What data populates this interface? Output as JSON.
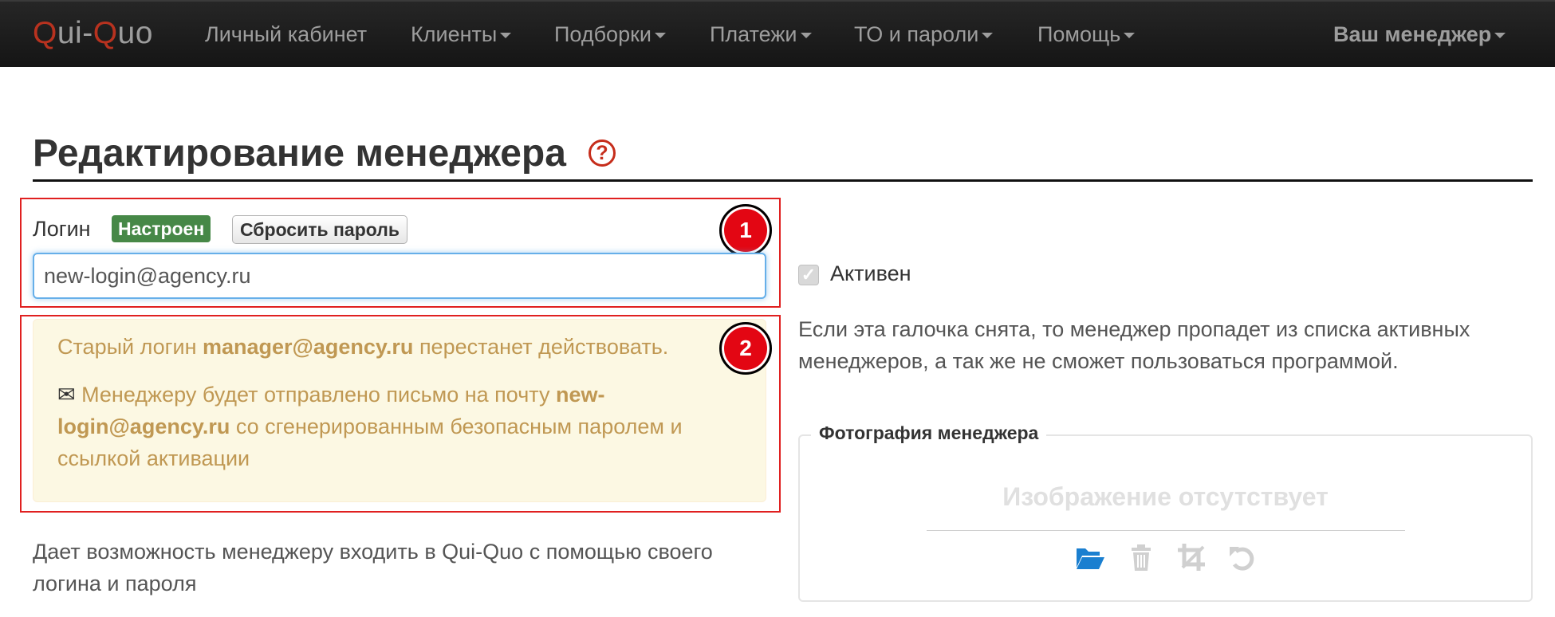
{
  "navbar": {
    "brand_q1": "Q",
    "brand_mid": "ui-",
    "brand_q2": "Q",
    "brand_end": "uo",
    "items": [
      {
        "label": "Личный кабинет"
      },
      {
        "label": "Клиенты"
      },
      {
        "label": "Подборки"
      },
      {
        "label": "Платежи"
      },
      {
        "label": "ТО и пароли"
      },
      {
        "label": "Помощь"
      }
    ],
    "manager_menu": "Ваш менеджер"
  },
  "page": {
    "title": "Редактирование менеджера",
    "help_symbol": "?"
  },
  "annotations": {
    "badge1": "1",
    "badge2": "2"
  },
  "login": {
    "label": "Логин",
    "status": "Настроен",
    "reset_button": "Сбросить пароль",
    "value": "new-login@agency.ru",
    "help_text": "Дает возможность менеджеру входить в Qui-Quo с помощью своего логина и пароля"
  },
  "warning": {
    "line1_prefix": "Старый логин ",
    "line1_email": "manager@agency.ru",
    "line1_suffix": " перестанет действовать.",
    "mail_glyph": "✉",
    "line2_prefix": " Менеджеру будет отправлено письмо на почту ",
    "line2_email": "new-login@agency.ru",
    "line2_suffix": " со сгенерированным безопасным паролем и ссылкой активации"
  },
  "active": {
    "label": "Активен",
    "checked": true,
    "help_text": "Если эта галочка снята, то менеджер пропадет из списка активных менеджеров, а так же не сможет пользоваться программой."
  },
  "photo": {
    "legend": "Фотография менеджера",
    "empty_text": "Изображение отсутствует",
    "tools": [
      "folder-open-icon",
      "trash-icon",
      "crop-icon",
      "undo-icon"
    ],
    "accent_color": "#1a7fd0"
  },
  "colors": {
    "brand_red": "#b8321f",
    "annotation_red": "#e30613",
    "success_green": "#468847",
    "warning_text": "#c09853",
    "warning_bg": "#fcf8e3"
  }
}
